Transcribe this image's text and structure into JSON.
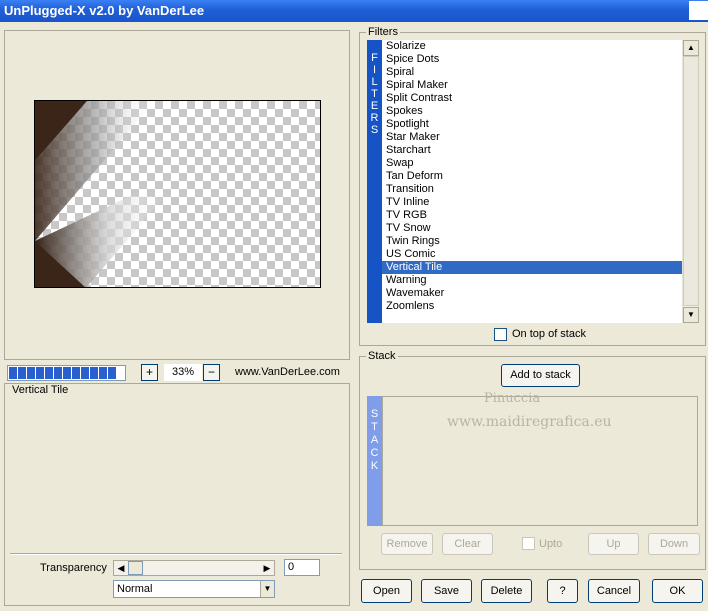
{
  "window": {
    "title": "UnPlugged-X v2.0 by VanDerLee"
  },
  "preview": {
    "zoom_in_label": "+",
    "zoom_value": "33%",
    "zoom_out_label": "−",
    "website": "www.VanDerLee.com",
    "progress_segments": 12
  },
  "description": {
    "title": "Vertical Tile",
    "transparency_label": "Transparency",
    "transparency_value": "0",
    "blend_mode": "Normal"
  },
  "filters": {
    "group_label": "Filters",
    "strip_label": [
      "F",
      "I",
      "L",
      "T",
      "E",
      "R",
      "S"
    ],
    "items": [
      "Solarize",
      "Spice Dots",
      "Spiral",
      "Spiral Maker",
      "Split Contrast",
      "Spokes",
      "Spotlight",
      "Star Maker",
      "Starchart",
      "Swap",
      "Tan Deform",
      "Transition",
      "TV Inline",
      "TV RGB",
      "TV Snow",
      "Twin Rings",
      "US Comic",
      "Vertical Tile",
      "Warning",
      "Wavemaker",
      "Zoomlens"
    ],
    "selected": "Vertical Tile",
    "on_top_label": "On top of stack"
  },
  "stack": {
    "group_label": "Stack",
    "add_button": "Add to stack",
    "strip_label": [
      "S",
      "T",
      "A",
      "C",
      "K"
    ],
    "watermark_line1": "Pinuccia",
    "watermark_line2": "www.maidiregrafica.eu",
    "remove_button": "Remove",
    "clear_button": "Clear",
    "upto_label": "Upto",
    "up_button": "Up",
    "down_button": "Down"
  },
  "buttons": {
    "open": "Open",
    "save": "Save",
    "delete": "Delete",
    "help": "?",
    "cancel": "Cancel",
    "ok": "OK"
  },
  "colors": {
    "titlebar": "#1f5fd6",
    "selection": "#316ac5",
    "filters_strip": "#1653c5",
    "stack_strip": "#7f9de8",
    "image_brown": "#3b2518"
  }
}
